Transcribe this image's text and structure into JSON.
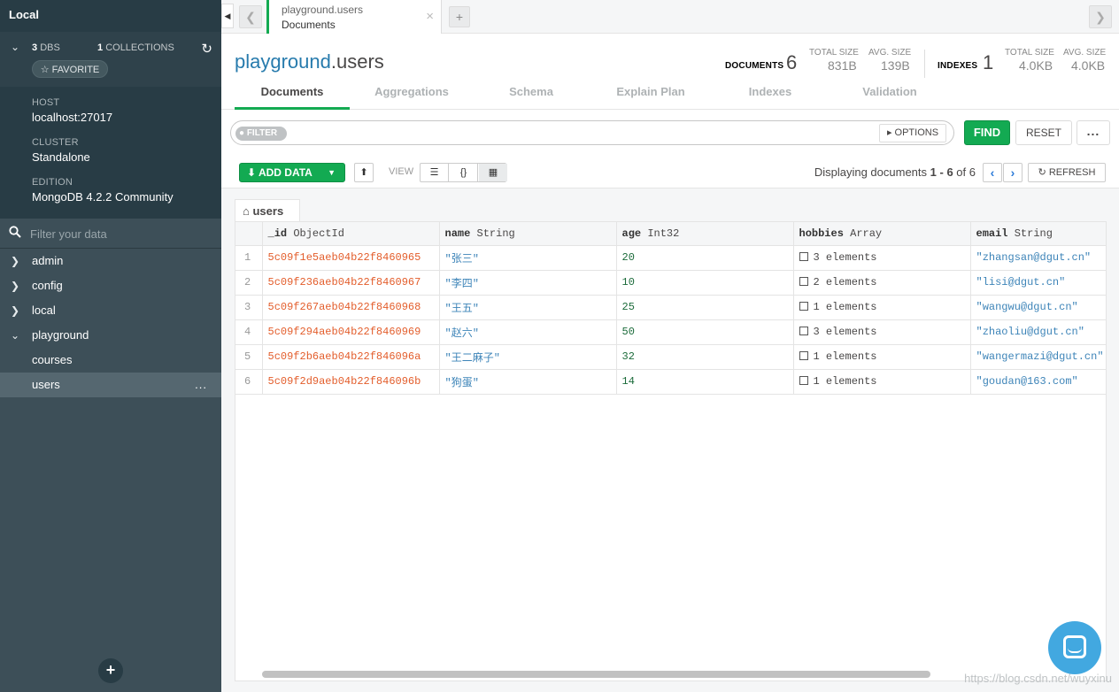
{
  "sidebar": {
    "title": "Local",
    "dbs_count": "3",
    "dbs_label": "DBS",
    "collections_count": "1",
    "collections_label": "COLLECTIONS",
    "favorite_label": "☆ FAVORITE",
    "host_label": "HOST",
    "host_value": "localhost:27017",
    "cluster_label": "CLUSTER",
    "cluster_value": "Standalone",
    "edition_label": "EDITION",
    "edition_value": "MongoDB 4.2.2 Community",
    "filter_placeholder": "Filter your data",
    "databases": [
      {
        "name": "admin",
        "expanded": false
      },
      {
        "name": "config",
        "expanded": false
      },
      {
        "name": "local",
        "expanded": false
      },
      {
        "name": "playground",
        "expanded": true
      }
    ],
    "collections": [
      {
        "name": "courses",
        "active": false
      },
      {
        "name": "users",
        "active": true
      }
    ],
    "more_label": "...",
    "add_label": "+"
  },
  "tabbar": {
    "tab_namespace": "playground.users",
    "tab_label": "Documents",
    "close_label": "×",
    "new_tab_label": "+"
  },
  "header": {
    "db_name": "playground",
    "coll_name": ".users",
    "documents_label": "DOCUMENTS",
    "documents_count": "6",
    "docs_total_size_label": "TOTAL SIZE",
    "docs_total_size": "831B",
    "docs_avg_size_label": "AVG. SIZE",
    "docs_avg_size": "139B",
    "indexes_label": "INDEXES",
    "indexes_count": "1",
    "idx_total_size_label": "TOTAL SIZE",
    "idx_total_size": "4.0KB",
    "idx_avg_size_label": "AVG. SIZE",
    "idx_avg_size": "4.0KB"
  },
  "subtabs": [
    "Documents",
    "Aggregations",
    "Schema",
    "Explain Plan",
    "Indexes",
    "Validation"
  ],
  "query": {
    "filter_label": "FILTER",
    "filter_value": "",
    "options_label": "OPTIONS",
    "find_label": "FIND",
    "reset_label": "RESET",
    "more_label": "..."
  },
  "toolbar": {
    "add_data_label": "ADD DATA",
    "view_label": "VIEW",
    "display_prefix": "Displaying documents",
    "display_range": "1 - 6",
    "display_of": "of",
    "display_total": "6",
    "refresh_label": "REFRESH"
  },
  "grid": {
    "collection_tab": "users",
    "columns": [
      {
        "field": "_id",
        "type": "ObjectId"
      },
      {
        "field": "name",
        "type": "String"
      },
      {
        "field": "age",
        "type": "Int32"
      },
      {
        "field": "hobbies",
        "type": "Array"
      },
      {
        "field": "email",
        "type": "String"
      }
    ],
    "rows": [
      {
        "n": "1",
        "id": "5c09f1e5aeb04b22f8460965",
        "name": "\"张三\"",
        "age": "20",
        "hobbies": "3 elements",
        "email": "\"zhangsan@dgut.cn\""
      },
      {
        "n": "2",
        "id": "5c09f236aeb04b22f8460967",
        "name": "\"李四\"",
        "age": "10",
        "hobbies": "2 elements",
        "email": "\"lisi@dgut.cn\""
      },
      {
        "n": "3",
        "id": "5c09f267aeb04b22f8460968",
        "name": "\"王五\"",
        "age": "25",
        "hobbies": "1 elements",
        "email": "\"wangwu@dgut.cn\""
      },
      {
        "n": "4",
        "id": "5c09f294aeb04b22f8460969",
        "name": "\"赵六\"",
        "age": "50",
        "hobbies": "3 elements",
        "email": "\"zhaoliu@dgut.cn\""
      },
      {
        "n": "5",
        "id": "5c09f2b6aeb04b22f846096a",
        "name": "\"王二麻子\"",
        "age": "32",
        "hobbies": "1 elements",
        "email": "\"wangermazi@dgut.cn\""
      },
      {
        "n": "6",
        "id": "5c09f2d9aeb04b22f846096b",
        "name": "\"狗蛋\"",
        "age": "14",
        "hobbies": "1 elements",
        "email": "\"goudan@163.com\""
      }
    ]
  },
  "watermark": "https://blog.csdn.net/wuyxinu",
  "colors": {
    "accent_green": "#13aa52",
    "sidebar_bg": "#3d4f58",
    "objectid": "#e35d2b",
    "string": "#3d84b8",
    "number": "#1b6b3a",
    "link_blue": "#277bad"
  }
}
